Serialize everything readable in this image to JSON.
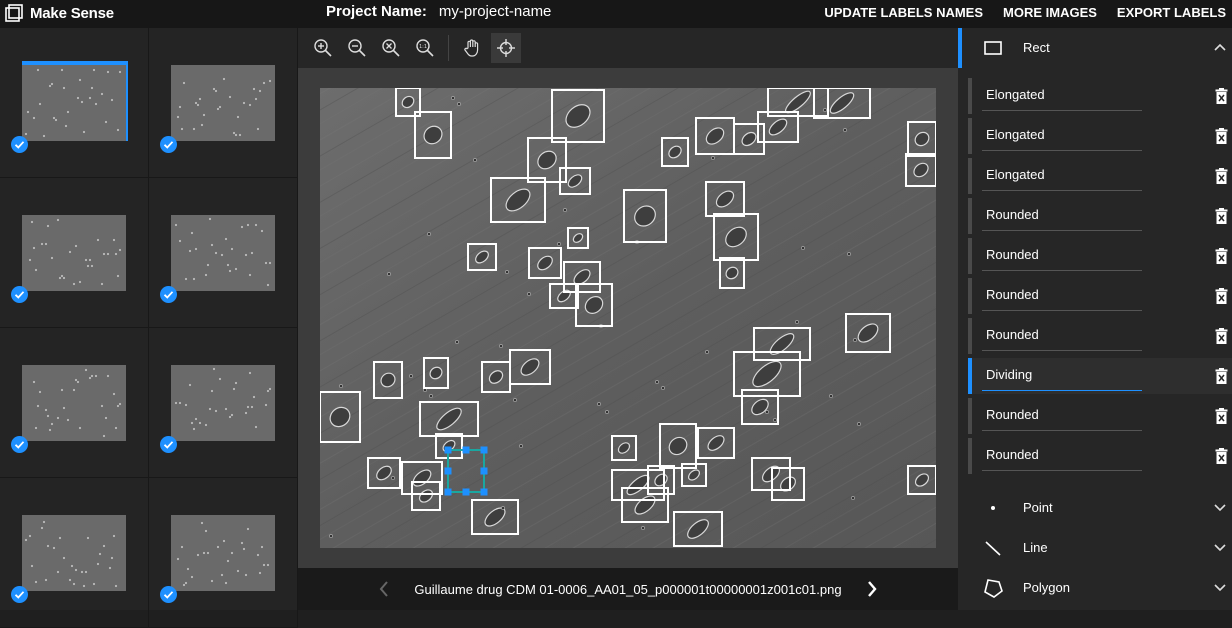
{
  "app": {
    "name": "Make Sense"
  },
  "project": {
    "label": "Project Name:",
    "value": "my-project-name"
  },
  "top_menu": [
    "UPDATE LABELS NAMES",
    "MORE IMAGES",
    "EXPORT LABELS"
  ],
  "thumbnails": {
    "count": 8,
    "selected_index": 0,
    "all_checked": true
  },
  "toolbar": {
    "tools": [
      "zoom-in",
      "zoom-out",
      "zoom-fit",
      "zoom-reset",
      "hand",
      "crosshair"
    ],
    "active": "crosshair"
  },
  "footer": {
    "filename": "Guillaume drug CDM 01-0006_AA01_05_p000001t00000001z001c01.png"
  },
  "right_panel": {
    "rect": {
      "label": "Rect",
      "expanded": true
    },
    "labels": [
      "Elongated",
      "Elongated",
      "Elongated",
      "Rounded",
      "Rounded",
      "Rounded",
      "Rounded",
      "Dividing",
      "Rounded",
      "Rounded"
    ],
    "active_label_index": 7,
    "point": {
      "label": "Point"
    },
    "line": {
      "label": "Line"
    },
    "polygon": {
      "label": "Polygon"
    }
  },
  "colors": {
    "accent": "#1e90ff",
    "box": "#ffffff",
    "selected_box": "#1aa7a0",
    "handle": "#1e90ff"
  }
}
